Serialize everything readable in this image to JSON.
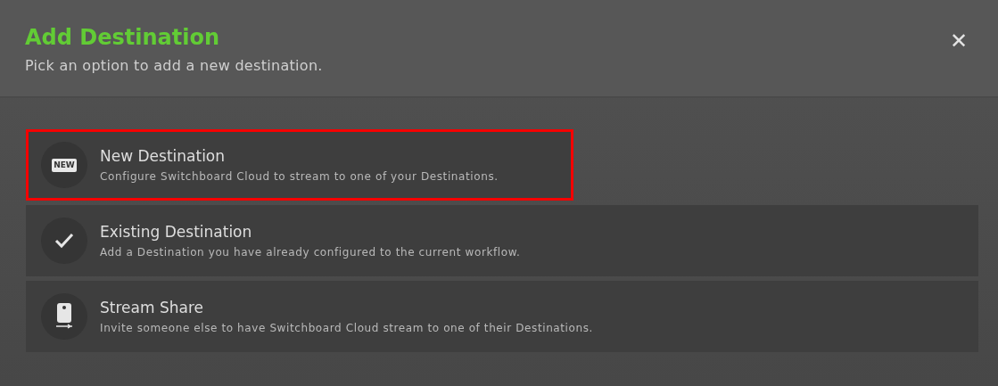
{
  "dialog": {
    "title": "Add Destination",
    "subtitle": "Pick an option to add a new destination.",
    "close": "✕"
  },
  "options": [
    {
      "kind": "new",
      "badge": "NEW",
      "title": "New Destination",
      "description": "Configure Switchboard Cloud to stream to one of your Destinations.",
      "highlighted": true
    },
    {
      "kind": "check",
      "title": "Existing Destination",
      "description": "Add a Destination you have already configured to the current workflow.",
      "highlighted": false
    },
    {
      "kind": "device",
      "title": "Stream Share",
      "description": "Invite someone else to have Switchboard Cloud stream to one of their Destinations.",
      "highlighted": false
    }
  ]
}
